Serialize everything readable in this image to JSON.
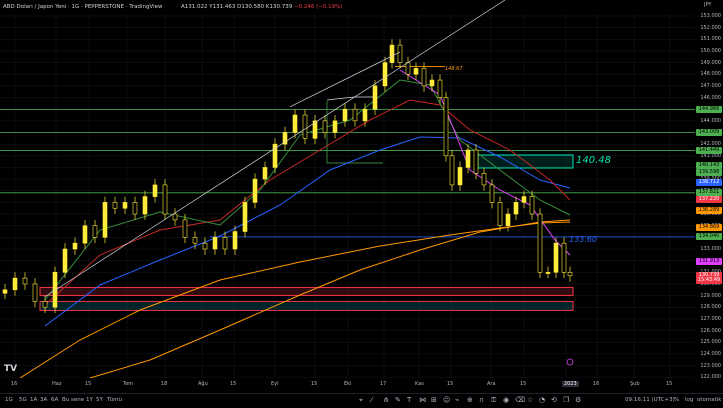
{
  "header": {
    "title": "ABD Doları / Japon Yeni · 1G · PEPPERSTONE · TradingView",
    "open": "A131.022",
    "high": "Y131.463",
    "low": "D130.580",
    "close": "K130.739",
    "change": "−0.246 (−0.19%)"
  },
  "price_axis": {
    "currency": "JPY",
    "ticks": [
      "153.000",
      "152.000",
      "151.000",
      "150.000",
      "149.000",
      "148.000",
      "147.000",
      "146.000",
      "145.000",
      "144.000",
      "143.000",
      "142.000",
      "141.000",
      "140.000",
      "139.000",
      "138.000",
      "137.000",
      "136.000",
      "135.000",
      "134.000",
      "133.000",
      "132.000",
      "131.000",
      "130.000",
      "129.000",
      "128.000",
      "127.000",
      "126.000",
      "125.000",
      "124.000",
      "123.000",
      "122.000"
    ],
    "labels": [
      {
        "text": "144.966",
        "color": "#4caf50",
        "price": 144.966
      },
      {
        "text": "143.009",
        "color": "#4caf50",
        "price": 143.009
      },
      {
        "text": "141.449",
        "color": "#4caf50",
        "price": 141.449
      },
      {
        "text": "140.143",
        "color": "#4caf50",
        "price": 140.143
      },
      {
        "text": "139.598",
        "color": "#4caf50",
        "price": 139.598
      },
      {
        "text": "138.712",
        "color": "#2962ff",
        "price": 138.712
      },
      {
        "text": "137.821",
        "color": "#4caf50",
        "price": 137.821
      },
      {
        "text": "137.220",
        "color": "#f23645",
        "price": 137.22
      },
      {
        "text": "136.289",
        "color": "#ff9800",
        "price": 136.289
      },
      {
        "text": "134.869",
        "color": "#ff9800",
        "price": 134.869
      },
      {
        "text": "134.040",
        "color": "#4caf50",
        "price": 134.04
      },
      {
        "text": "131.913",
        "color": "#e040fb",
        "price": 131.913
      },
      {
        "text": "130.739",
        "color": "#f23645",
        "price": 130.739
      },
      {
        "text": "15:43:49",
        "color": "#f23645",
        "price": 130.3
      }
    ]
  },
  "time_axis": [
    "16",
    "Haz",
    "15",
    "Tem",
    "18",
    "Ağu",
    "15",
    "Eyl",
    "15",
    "Eki",
    "17",
    "Kas",
    "15",
    "Ara",
    "15",
    "2023",
    "16",
    "Şub",
    "15"
  ],
  "annotations": {
    "level_148": "148.67",
    "level_140": "140.48",
    "level_133": "133.60"
  },
  "bottom_bar": {
    "timeframes": [
      "1G",
      "5G",
      "1A",
      "3A",
      "6A",
      "Bu sene",
      "1Y",
      "5Y",
      "Tümü"
    ],
    "clock": "09:16:11 (UTC+3)",
    "percent": "%",
    "log": "log",
    "auto": "otomatik"
  },
  "tv_logo": "TV",
  "colors": {
    "background": "#000000",
    "candle": "#ffeb3b",
    "support_zone": "#f23645",
    "green_line": "#4caf50",
    "blue_line": "#2962ff",
    "orange_ma": "#ff9800",
    "teal_box": "#00e5b0"
  }
}
